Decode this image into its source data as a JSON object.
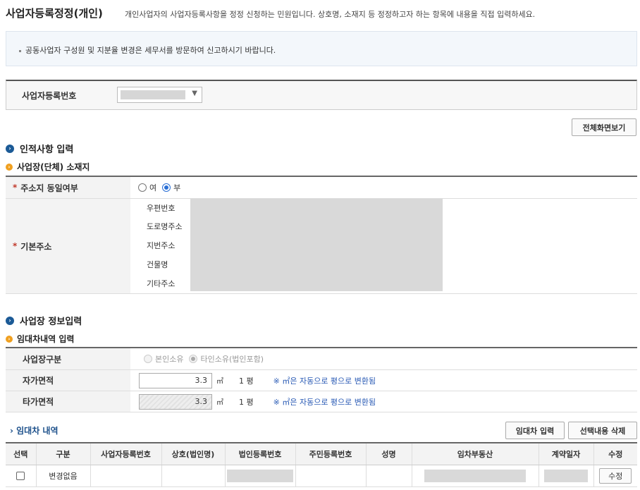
{
  "header": {
    "title": "사업자등록정정(개인)",
    "description": "개인사업자의 사업자등록사항을 정정 신청하는 민원입니다. 상호명, 소재지 등 정정하고자 하는 항목에 내용을 직접 입력하세요."
  },
  "notice": {
    "text": "공동사업자 구성원 및 지분율 변경은 세무서를 방문하여 신고하시기 바랍니다."
  },
  "registration": {
    "label": "사업자등록번호"
  },
  "buttons": {
    "fullscreen": "전체화면보기",
    "lease_input": "임대차 입력",
    "delete_selected": "선택내용 삭제",
    "edit": "수정"
  },
  "section_personal": {
    "title": "인적사항 입력",
    "subtitle": "사업장(단체) 소재지",
    "same_address": {
      "label": "주소지 동일여부",
      "options": [
        "여",
        "부"
      ],
      "selected": "부"
    },
    "base_address": {
      "label": "기본주소",
      "fields": [
        "우편번호",
        "도로명주소",
        "지번주소",
        "건물명",
        "기타주소"
      ]
    }
  },
  "section_business": {
    "title": "사업장 정보입력",
    "subtitle": "임대차내역 입력",
    "type": {
      "label": "사업장구분",
      "options": [
        "본인소유",
        "타인소유(법인포함)"
      ],
      "selected": "타인소유(법인포함)"
    },
    "own_area": {
      "label": "자가면적",
      "value": "3.3",
      "unit": "㎡",
      "pyeong": "1 평",
      "note": "※ ㎡은 자동으로 평으로 변환됨"
    },
    "other_area": {
      "label": "타가면적",
      "value": "3.3",
      "unit": "㎡",
      "pyeong": "1 평",
      "note": "※ ㎡은 자동으로 평으로 변환됨"
    }
  },
  "lease": {
    "title": "› 임대차 내역",
    "columns": [
      "선택",
      "구분",
      "사업자등록번호",
      "상호(법인명)",
      "법인등록번호",
      "주민등록번호",
      "성명",
      "임차부동산",
      "계약일자",
      "수정"
    ],
    "rows": [
      {
        "type": "변경없음"
      }
    ]
  },
  "icons": {
    "section": "circle-arrow-icon",
    "subsection": "circle-arrow-icon"
  },
  "colors": {
    "accent_blue": "#1b5a96",
    "accent_orange": "#f0a020",
    "required": "#c0392b",
    "note_blue": "#2a5bb5"
  }
}
